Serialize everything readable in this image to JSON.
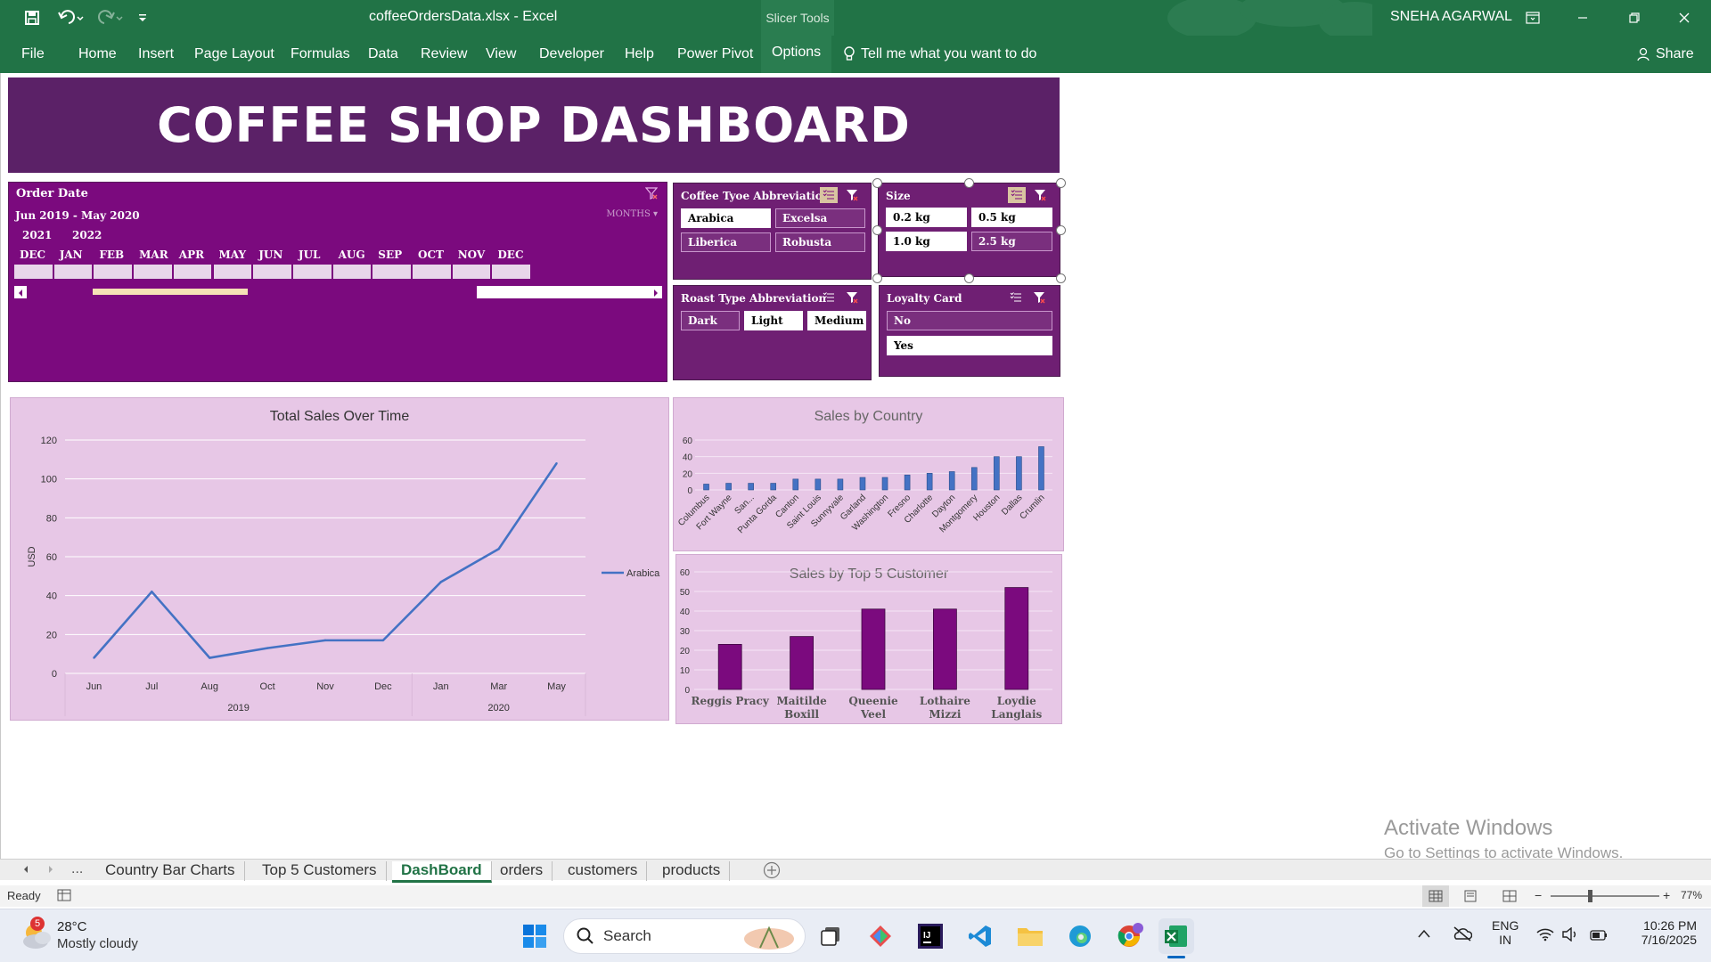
{
  "window": {
    "doc_title": "coffeeOrdersData.xlsx  -  Excel",
    "context_tab": "Slicer Tools",
    "user": "SNEHA AGARWAL"
  },
  "ribbon": {
    "tabs": [
      "File",
      "Home",
      "Insert",
      "Page Layout",
      "Formulas",
      "Data",
      "Review",
      "View",
      "Developer",
      "Help",
      "Power Pivot",
      "Options"
    ],
    "active_tab": "Options",
    "tell_me": "Tell me what you want to do",
    "share": "Share"
  },
  "dashboard": {
    "title": "COFFEE SHOP DASHBOARD"
  },
  "timeline": {
    "title": "Order Date",
    "range": "Jun 2019 - May 2020",
    "level": "MONTHS",
    "years": [
      "2021",
      "2022"
    ],
    "months": [
      "DEC",
      "JAN",
      "FEB",
      "MAR",
      "APR",
      "MAY",
      "JUN",
      "JUL",
      "AUG",
      "SEP",
      "OCT",
      "NOV",
      "DEC"
    ]
  },
  "slicers": {
    "coffee_type": {
      "title": "Coffee Tyoe Abbreviation",
      "items": [
        {
          "label": "Arabica",
          "selected": true
        },
        {
          "label": "Excelsa",
          "selected": false
        },
        {
          "label": "Liberica",
          "selected": false
        },
        {
          "label": "Robusta",
          "selected": false
        }
      ]
    },
    "size": {
      "title": "Size",
      "items": [
        {
          "label": "0.2 kg",
          "selected": true
        },
        {
          "label": "0.5 kg",
          "selected": true
        },
        {
          "label": "1.0 kg",
          "selected": true
        },
        {
          "label": "2.5 kg",
          "selected": false
        }
      ]
    },
    "roast_type": {
      "title": "Roast Type Abbreviation",
      "items": [
        {
          "label": "Dark",
          "selected": false
        },
        {
          "label": "Light",
          "selected": true
        },
        {
          "label": "Medium",
          "selected": true
        }
      ]
    },
    "loyalty": {
      "title": "Loyalty Card",
      "items": [
        {
          "label": "No",
          "selected": false
        },
        {
          "label": "Yes",
          "selected": true
        }
      ]
    }
  },
  "chart_data": [
    {
      "type": "line",
      "title": "Total Sales Over Time",
      "ylabel": "USD",
      "xlabel": "",
      "ylim": [
        0,
        120
      ],
      "yticks": [
        0,
        20,
        40,
        60,
        80,
        100,
        120
      ],
      "categories": [
        "Jun",
        "Jul",
        "Aug",
        "Oct",
        "Nov",
        "Dec",
        "Jan",
        "Mar",
        "May"
      ],
      "year_groups": [
        {
          "label": "2019",
          "span": 6
        },
        {
          "label": "2020",
          "span": 3
        }
      ],
      "series": [
        {
          "name": "Arabica",
          "values": [
            8,
            42,
            8,
            13,
            17,
            17,
            47,
            64,
            108
          ],
          "color": "#4472c4"
        }
      ],
      "legend": "right"
    },
    {
      "type": "bar",
      "title": "Sales by Country",
      "ylim": [
        0,
        60
      ],
      "yticks": [
        0,
        20,
        40,
        60
      ],
      "categories": [
        "Columbus",
        "Fort Wayne",
        "San...",
        "Punta Gorda",
        "Canton",
        "Saint Louis",
        "Sunnyvale",
        "Garland",
        "Washington",
        "Fresno",
        "Charlotte",
        "Dayton",
        "Montgomery",
        "Houston",
        "Dallas",
        "Crumlin"
      ],
      "values": [
        7,
        8,
        8,
        8,
        13,
        13,
        13,
        15,
        15,
        18,
        20,
        22,
        27,
        40,
        40,
        52
      ],
      "color": "#4472c4"
    },
    {
      "type": "bar",
      "title": "Sales by Top 5 Customer",
      "ylim": [
        0,
        60
      ],
      "yticks": [
        0,
        10,
        20,
        30,
        40,
        50,
        60
      ],
      "categories": [
        "Reggis Pracy",
        "Maitilde Boxill",
        "Queenie Veel",
        "Lothaire Mizzi",
        "Loydie Langlais"
      ],
      "values": [
        23,
        27,
        41,
        41,
        52
      ],
      "color": "#7b0a7e"
    }
  ],
  "sheet_tabs": [
    "Country Bar Charts",
    "Top 5 Customers",
    "DashBoard",
    "orders",
    "customers",
    "products"
  ],
  "active_sheet": "DashBoard",
  "status": {
    "ready": "Ready",
    "zoom": "77%"
  },
  "watermark": {
    "line1": "Activate Windows",
    "line2": "Go to Settings to activate Windows."
  },
  "taskbar": {
    "weather_temp": "28°C",
    "weather_desc": "Mostly cloudy",
    "weather_badge": "5",
    "search": "Search",
    "lang1": "ENG",
    "lang2": "IN",
    "time": "10:26 PM",
    "date": "7/16/2025"
  }
}
